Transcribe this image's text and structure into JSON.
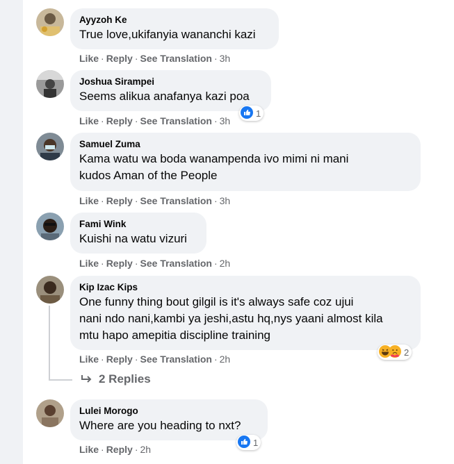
{
  "comments": [
    {
      "name": "Ayyzoh Ke",
      "text": [
        "True love,ukifanyia wananchi kazi"
      ],
      "actions": {
        "like": "Like",
        "reply": "Reply",
        "see_translation": "See Translation",
        "time": "3h"
      },
      "reaction": null
    },
    {
      "name": "Joshua Sirampei",
      "text": [
        "Seems alikua anafanya kazi poa"
      ],
      "actions": {
        "like": "Like",
        "reply": "Reply",
        "see_translation": "See Translation",
        "time": "3h"
      },
      "reaction": {
        "icons": [
          "like-icon"
        ],
        "count": "1"
      }
    },
    {
      "name": "Samuel Zuma",
      "text": [
        "Kama watu wa boda wanampenda ivo mimi ni mani",
        "kudos Aman of the People"
      ],
      "actions": {
        "like": "Like",
        "reply": "Reply",
        "see_translation": "See Translation",
        "time": "3h"
      },
      "reaction": null
    },
    {
      "name": "Fami Wink",
      "text": [
        "Kuishi na watu vizuri"
      ],
      "actions": {
        "like": "Like",
        "reply": "Reply",
        "see_translation": "See Translation",
        "time": "2h"
      },
      "reaction": null
    },
    {
      "name": "Kip Izac Kips",
      "text": [
        "One funny thing bout gilgil is it's always safe coz ujui",
        "nani ndo nani,kambi ya jeshi,astu hq,nys yaani almost kila",
        "mtu hapo amepitia discipline training"
      ],
      "actions": {
        "like": "Like",
        "reply": "Reply",
        "see_translation": "See Translation",
        "time": "2h"
      },
      "reaction": {
        "icons": [
          "haha-icon",
          "care-icon"
        ],
        "count": "2"
      }
    },
    {
      "name": "Lulei Morogo",
      "text": [
        "Where are you heading to nxt?"
      ],
      "actions": {
        "like": "Like",
        "reply": "Reply",
        "see_translation": null,
        "time": "2h"
      },
      "reaction": {
        "icons": [
          "like-icon"
        ],
        "count": "1"
      }
    }
  ],
  "replies": {
    "label": "2 Replies",
    "icon": "reply-arrow-icon"
  },
  "colors": {
    "bubble": "#f0f2f5",
    "meta": "#65676b",
    "like_blue": "#1877f2",
    "haha_yellow": "#f7b125"
  }
}
